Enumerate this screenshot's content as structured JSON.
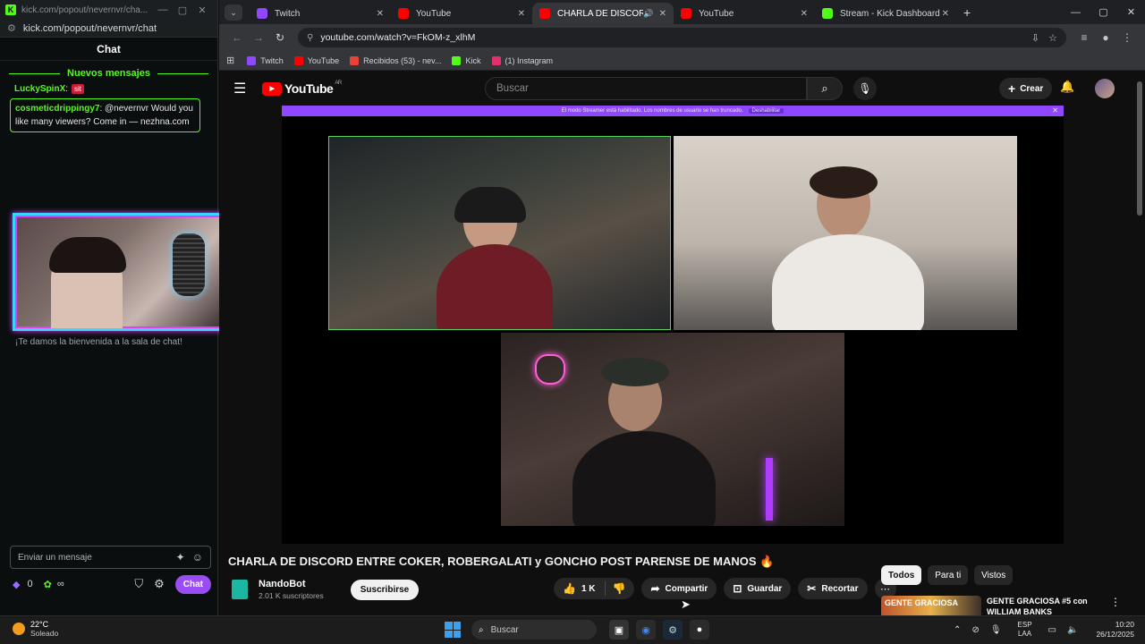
{
  "kick": {
    "window_title": "kick.com/popout/nevernvr/cha...",
    "url": "kick.com/popout/nevernvr/chat",
    "chat_header": "Chat",
    "new_messages": "Nuevos mensajes",
    "messages": [
      {
        "user": "LuckySpinX",
        "text": "sit"
      },
      {
        "user": "cosmeticdrippingy7",
        "text": ": @nevernvr Would you like many viewers? Come in — nezhna.com"
      }
    ],
    "welcome": "¡Te damos la bienvenida a la sala de chat!",
    "input_placeholder": "Enviar un mensaje",
    "points": "0",
    "infinity": "∞",
    "chat_button": "Chat",
    "brand_color": "#53fc18"
  },
  "chrome": {
    "tabs": [
      {
        "title": "Twitch",
        "color": "#9146ff",
        "active": false
      },
      {
        "title": "YouTube",
        "color": "#ff0000",
        "active": false
      },
      {
        "title": "CHARLA DE DISCORD ENTRE",
        "color": "#ff0000",
        "active": true
      },
      {
        "title": "YouTube",
        "color": "#ff0000",
        "active": false
      },
      {
        "title": "Stream - Kick Dashboard",
        "color": "#53fc18",
        "active": false
      }
    ],
    "url": "youtube.com/watch?v=FkOM-z_xlhM",
    "bookmarks": [
      {
        "label": "Twitch",
        "color": "#9146ff"
      },
      {
        "label": "YouTube",
        "color": "#ff0000"
      },
      {
        "label": "Recibidos (53) - nev...",
        "color": "#ea4335"
      },
      {
        "label": "Kick",
        "color": "#53fc18"
      },
      {
        "label": "(1) Instagram",
        "color": "#e1306c"
      }
    ]
  },
  "youtube": {
    "logo": "YouTube",
    "region": "AR",
    "search_placeholder": "Buscar",
    "create": "Crear",
    "streamer_bar": "El modo Streamer está habilitado. Los nombres de usuario se han truncado.",
    "streamer_bar_btn": "Deshabilitar",
    "video_title": "CHARLA DE DISCORD ENTRE COKER, ROBERGALATI y GONCHO POST PARENSE DE MANOS 🔥",
    "channel_name": "NandoBot",
    "subscribers": "2.01 K suscriptores",
    "subscribe": "Suscribirse",
    "likes": "1 K",
    "share": "Compartir",
    "save": "Guardar",
    "clip": "Recortar",
    "chips": [
      "Todos",
      "Para ti",
      "Vistos"
    ],
    "rec_thumb_text": "GENTE GRACIOSA",
    "rec_title": "GENTE GRACIOSA #5 con WILLIAM BANKS"
  },
  "taskbar": {
    "temp": "22°C",
    "weather": "Soleado",
    "search": "Buscar",
    "lang1": "ESP",
    "lang2": "LAA",
    "time": "10:20",
    "date": "26/12/2025"
  }
}
